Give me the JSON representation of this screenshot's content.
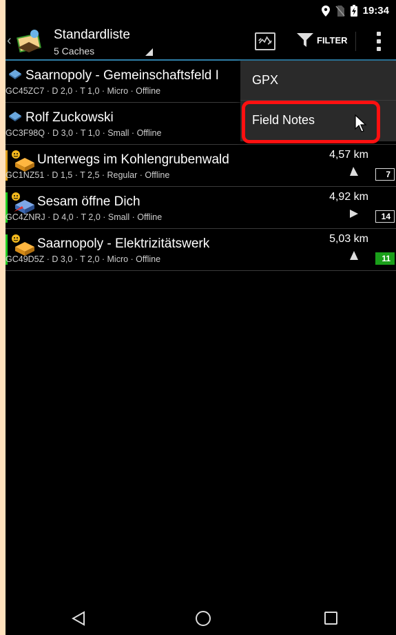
{
  "status_bar": {
    "time": "19:34",
    "icons": [
      "location-pin-icon",
      "no-sim-icon",
      "battery-charging-icon"
    ]
  },
  "action_bar": {
    "title": "Standardliste",
    "subtitle": "5 Caches",
    "filter_label": "FILTER"
  },
  "caches": [
    {
      "name": "Saarnopoly - Gemeinschaftsfeld I",
      "meta": "GC45ZC7 · D 2,0 · T 1,0 · Micro · Offline",
      "distance": "",
      "badge": "",
      "icon": "traditional-cache-icon"
    },
    {
      "name": "Rolf Zuckowski",
      "meta": "GC3F98Q · D 3,0 · T 1,0 · Small · Offline",
      "distance": "",
      "badge": "",
      "icon": "traditional-cache-icon"
    },
    {
      "name": "Unterwegs im Kohlengrubenwald",
      "meta": "GC1NZ51 · D 1,5 · T 2,5 · Regular · Offline",
      "distance": "4,57 km",
      "badge": "7",
      "icon": "multi-cache-icon"
    },
    {
      "name": "Sesam öffne Dich",
      "meta": "GC4ZNRJ · D 4,0 · T 2,0 · Small · Offline",
      "distance": "4,92 km",
      "badge": "14",
      "icon": "mystery-cache-icon"
    },
    {
      "name": "Saarnopoly - Elektrizitätswerk",
      "meta": "GC49D5Z · D 3,0 · T 2,0 · Micro · Offline",
      "distance": "5,03 km",
      "badge": "11",
      "icon": "multi-cache-icon"
    }
  ],
  "overflow_menu": {
    "items": [
      "GPX",
      "Field Notes"
    ]
  },
  "colors": {
    "accent_line": "#2f7fa7",
    "highlight": "#ff1010",
    "row3_bar": "#e0a020",
    "row4_bar": "#22cc22",
    "row5_bar": "#22cc22",
    "badge_green": "#1a9f1a"
  }
}
